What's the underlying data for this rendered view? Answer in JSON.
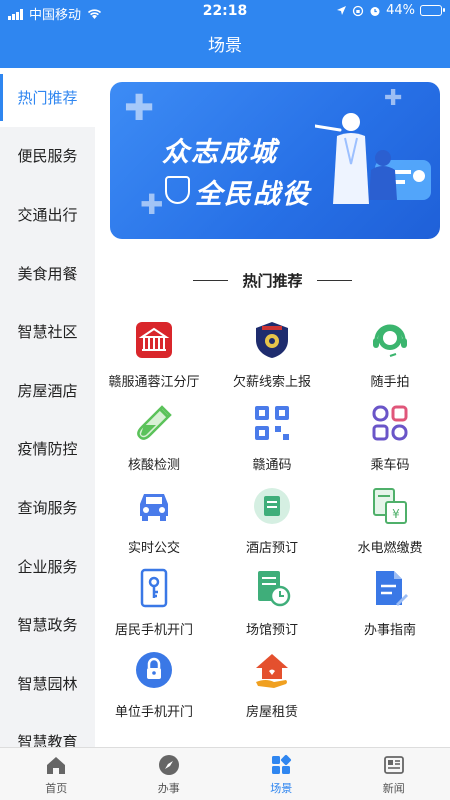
{
  "status_bar": {
    "carrier": "中国移动",
    "time": "22:18",
    "battery": "44%",
    "battery_level": 0.44
  },
  "nav": {
    "title": "场景"
  },
  "sidebar": {
    "items": [
      {
        "label": "热门推荐",
        "active": true
      },
      {
        "label": "便民服务"
      },
      {
        "label": "交通出行"
      },
      {
        "label": "美食用餐"
      },
      {
        "label": "智慧社区"
      },
      {
        "label": "房屋酒店"
      },
      {
        "label": "疫情防控"
      },
      {
        "label": "查询服务"
      },
      {
        "label": "企业服务"
      },
      {
        "label": "智慧政务"
      },
      {
        "label": "智慧园林"
      },
      {
        "label": "智慧教育"
      }
    ]
  },
  "banner": {
    "line1": "众志成城",
    "line2": "全民战役"
  },
  "section": {
    "title": "热门推荐"
  },
  "services": [
    {
      "label": "赣服通蓉江分厅",
      "icon": "building-icon",
      "color": "#d9262b"
    },
    {
      "label": "欠薪线索上报",
      "icon": "police-badge-icon",
      "color": "#1e2c6e"
    },
    {
      "label": "随手拍",
      "icon": "headset-icon",
      "color": "#3bb56e"
    },
    {
      "label": "核酸检测",
      "icon": "test-tube-icon",
      "color": "#5bc25a"
    },
    {
      "label": "赣通码",
      "icon": "qr-code-icon",
      "color": "#4a7bea"
    },
    {
      "label": "乘车码",
      "icon": "ride-code-icon",
      "color": "#6a55c8"
    },
    {
      "label": "实时公交",
      "icon": "car-icon",
      "color": "#4a7bea"
    },
    {
      "label": "酒店预订",
      "icon": "hotel-icon",
      "color": "#3fae7a"
    },
    {
      "label": "水电燃缴费",
      "icon": "bill-icon",
      "color": "#4fb06a"
    },
    {
      "label": "居民手机开门",
      "icon": "phone-key-icon",
      "color": "#3a78e6"
    },
    {
      "label": "场馆预订",
      "icon": "calendar-doc-icon",
      "color": "#3fae7a"
    },
    {
      "label": "办事指南",
      "icon": "guide-doc-icon",
      "color": "#3a78e6"
    },
    {
      "label": "单位手机开门",
      "icon": "lock-icon",
      "color": "#3a78e6"
    },
    {
      "label": "房屋租赁",
      "icon": "house-hand-icon",
      "color": "#e4502e"
    }
  ],
  "tabbar": {
    "tabs": [
      {
        "label": "首页",
        "icon": "home-icon"
      },
      {
        "label": "办事",
        "icon": "compass-icon"
      },
      {
        "label": "场景",
        "icon": "grid-icon",
        "active": true
      },
      {
        "label": "新闻",
        "icon": "news-icon"
      }
    ]
  }
}
